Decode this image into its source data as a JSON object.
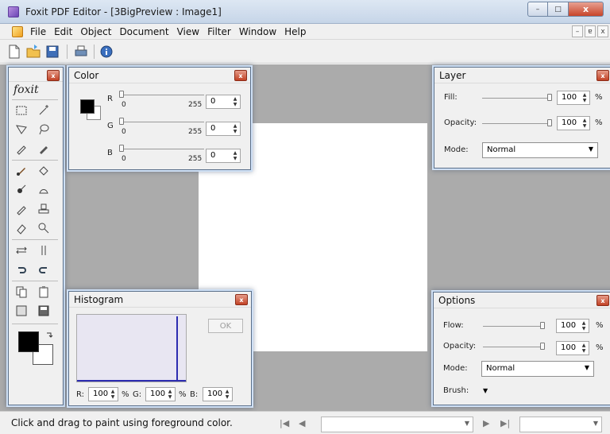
{
  "window": {
    "title": "Foxit PDF Editor - [3BigPreview : Image1]",
    "controls": {
      "minimize": "–",
      "maximize": "□",
      "close": "x"
    }
  },
  "menu": {
    "items": [
      "File",
      "Edit",
      "Object",
      "Document",
      "View",
      "Filter",
      "Window",
      "Help"
    ],
    "mdi_controls": [
      "–",
      "ɐ",
      "x"
    ]
  },
  "toolbar": {
    "buttons": [
      "new-document-icon",
      "open-folder-icon",
      "save-disk-icon",
      "print-icon",
      "info-icon"
    ]
  },
  "toolbox": {
    "logo": "foxit",
    "tools": [
      "rectangle-select-icon",
      "magic-wand-icon",
      "lasso-icon",
      "polygon-lasso-icon",
      "eyedropper-icon",
      "color-pick-icon",
      "brush-icon",
      "paint-bucket-icon",
      "blur-icon",
      "smudge-icon",
      "pencil-icon",
      "stamp-icon",
      "eraser-icon",
      "zoom-icon",
      "flip-horizontal-icon",
      "flip-vertical-icon",
      "undo-icon",
      "redo-icon",
      "copy-icon",
      "paste-icon",
      "import-icon",
      "save-icon"
    ],
    "foreground_color": "#000000",
    "background_color": "#ffffff"
  },
  "color_panel": {
    "title": "Color",
    "channels": [
      {
        "label": "R",
        "min": "0",
        "max": "255",
        "value": "0"
      },
      {
        "label": "G",
        "min": "0",
        "max": "255",
        "value": "0"
      },
      {
        "label": "B",
        "min": "0",
        "max": "255",
        "value": "0"
      }
    ]
  },
  "layer_panel": {
    "title": "Layer",
    "fill_label": "Fill:",
    "fill_value": "100",
    "opacity_label": "Opacity:",
    "opacity_value": "100",
    "unit": "%",
    "mode_label": "Mode:",
    "mode_value": "Normal"
  },
  "histogram_panel": {
    "title": "Histogram",
    "ok_label": "OK",
    "r_label": "R:",
    "r_value": "100",
    "g_label": "G:",
    "g_value": "100",
    "b_label": "B:",
    "b_value": "100",
    "unit": "%"
  },
  "options_panel": {
    "title": "Options",
    "flow_label": "Flow:",
    "flow_value": "100",
    "opacity_label": "Opacity:",
    "opacity_value": "100",
    "unit": "%",
    "mode_label": "Mode:",
    "mode_value": "Normal",
    "brush_label": "Brush:"
  },
  "status": {
    "message": "Click and drag to paint using foreground color."
  }
}
